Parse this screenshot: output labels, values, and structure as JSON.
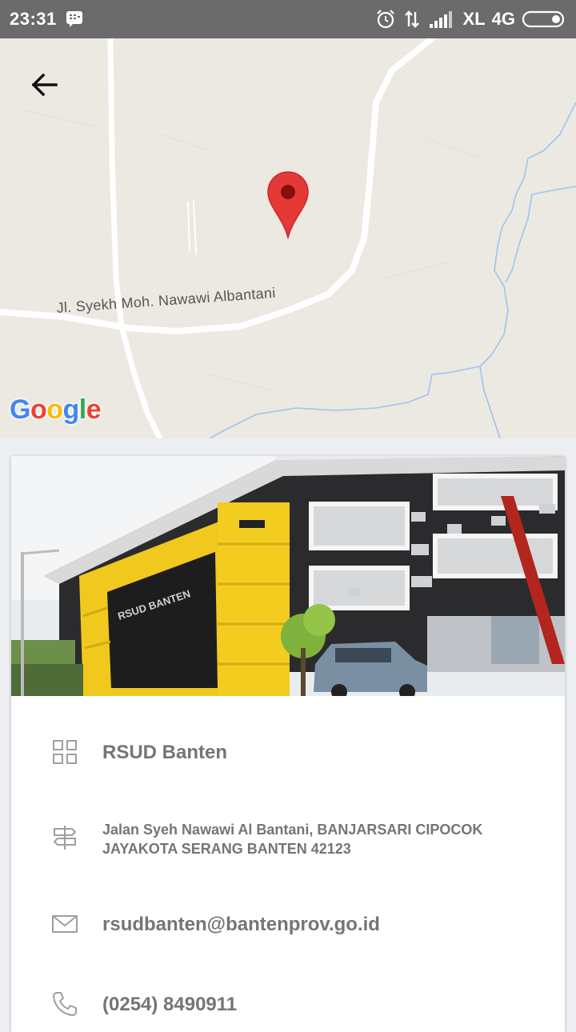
{
  "status_bar": {
    "time": "23:31",
    "carrier": "XL",
    "network": "4G",
    "icons": [
      "bbm-icon",
      "alarm-icon",
      "data-transfer-icon",
      "signal-icon",
      "battery-icon"
    ]
  },
  "map": {
    "street_name": "Jl. Syekh Moh. Nawawi Albantani",
    "attribution": "Google",
    "back_icon": "arrow-left-icon",
    "marker_icon": "map-pin-icon",
    "marker_color": "#e53935"
  },
  "place": {
    "name": "RSUD Banten",
    "address": "Jalan Syeh Nawawi Al Bantani, BANJARSARI CIPOCOK JAYAKOTA SERANG BANTEN 42123",
    "email": "rsudbanten@bantenprov.go.id",
    "phone": "(0254) 8490911",
    "icons": {
      "name": "grid-icon",
      "address": "signpost-icon",
      "email": "mail-icon",
      "phone": "phone-icon"
    }
  },
  "colors": {
    "status_bar": "#6b6b6b",
    "map_background": "#ebe9e1",
    "info_text": "#757575",
    "icon_gray": "#9e9e9e"
  }
}
